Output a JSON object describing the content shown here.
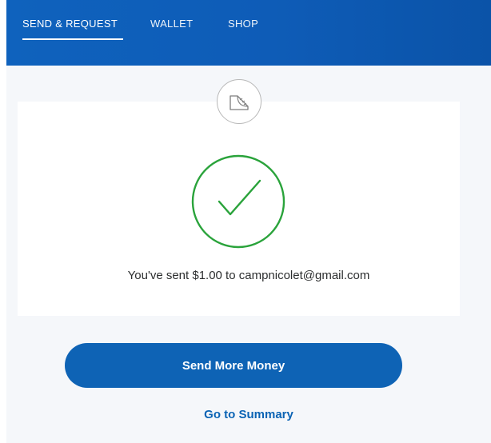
{
  "nav": {
    "items": [
      {
        "label": "SEND & REQUEST",
        "active": true
      },
      {
        "label": "WALLET",
        "active": false
      },
      {
        "label": "SHOP",
        "active": false
      }
    ]
  },
  "confirmation": {
    "message": "You've sent $1.00 to campnicolet@gmail.com",
    "status": "success"
  },
  "actions": {
    "primary_label": "Send More Money",
    "secondary_label": "Go to Summary"
  },
  "colors": {
    "nav_bg": "#0e5cb7",
    "success_green": "#2aa33b",
    "primary_button": "#0e63b5",
    "link": "#0a63b4",
    "page_bg": "#f5f7fa"
  },
  "icons": {
    "header_icon": "gift-card-icon",
    "status_icon": "checkmark-circle-icon"
  }
}
